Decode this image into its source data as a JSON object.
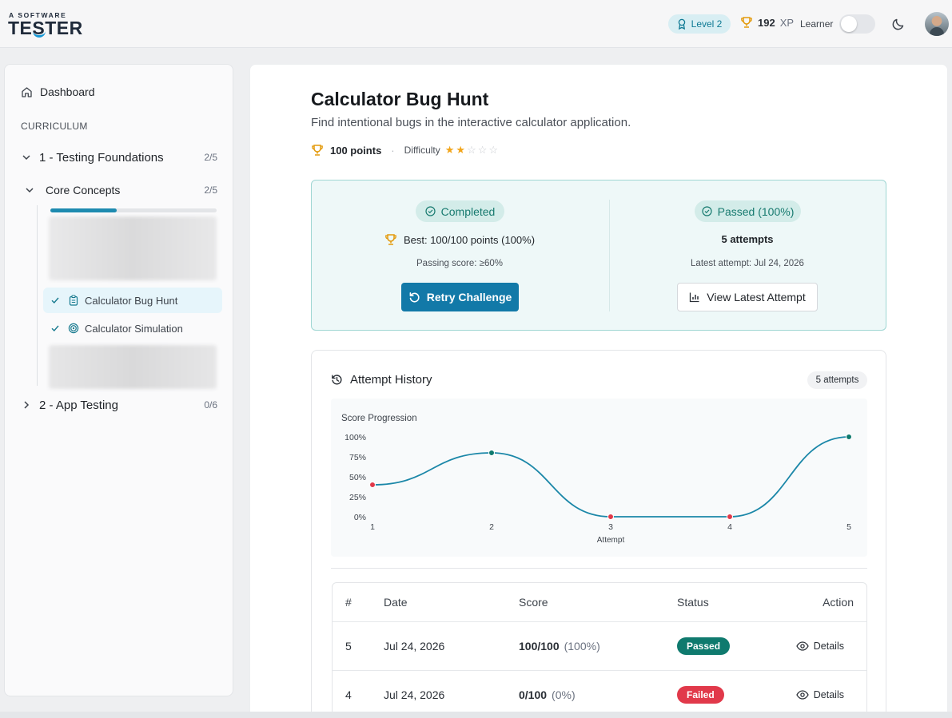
{
  "header": {
    "logo_small": "A SOFTWARE",
    "logo_big": "TESTER",
    "level": "Level 2",
    "xp_value": "192",
    "xp_unit": "XP",
    "role_label": "Learner"
  },
  "sidebar": {
    "dashboard": "Dashboard",
    "section": "CURRICULUM",
    "modules": [
      {
        "title": "1 - Testing Foundations",
        "count": "2/5"
      },
      {
        "title": "2 - App Testing",
        "count": "0/6"
      }
    ],
    "submodule": {
      "title": "Core Concepts",
      "count": "2/5",
      "progress": 0.4
    },
    "lessons": [
      {
        "title": "Calculator Bug Hunt"
      },
      {
        "title": "Calculator Simulation"
      }
    ]
  },
  "challenge": {
    "title": "Calculator Bug Hunt",
    "description": "Find intentional bugs in the interactive calculator application.",
    "points": "100 points",
    "difficulty_label": "Difficulty",
    "difficulty_rating": 2,
    "difficulty_max": 5
  },
  "status": {
    "completed": "Completed",
    "best": "Best: 100/100 points (100%)",
    "passing": "Passing score: ≥60%",
    "retry": "Retry Challenge",
    "passed": "Passed (100%)",
    "attempts": "5 attempts",
    "latest": "Latest attempt: Jul 24, 2026",
    "view_latest": "View Latest Attempt"
  },
  "history": {
    "title": "Attempt History",
    "badge": "5 attempts",
    "table_headers": [
      "#",
      "Date",
      "Score",
      "Status",
      "Action"
    ],
    "rows": [
      {
        "num": "5",
        "date": "Jul 24, 2026",
        "score": "100/100",
        "pct": "(100%)",
        "status": "Passed",
        "action": "Details"
      },
      {
        "num": "4",
        "date": "Jul 24, 2026",
        "score": "0/100",
        "pct": "(0%)",
        "status": "Failed",
        "action": "Details"
      }
    ]
  },
  "chart_data": {
    "type": "line",
    "title": "Score Progression",
    "xlabel": "Attempt",
    "ylabel": "",
    "x": [
      1,
      2,
      3,
      4,
      5
    ],
    "y_ticks": [
      "0%",
      "25%",
      "50%",
      "75%",
      "100%"
    ],
    "ylim": [
      0,
      100
    ],
    "series": [
      {
        "values": [
          40,
          80,
          0,
          0,
          100
        ]
      }
    ],
    "pass_threshold": 60,
    "colors": {
      "line": "#1b87a8",
      "pass": "#0f7a6e",
      "fail": "#e1394a"
    }
  },
  "colors": {
    "accent": "#1279a8",
    "passed": "#0f7a6e",
    "failed": "#e1394a",
    "star": "#f2a51a"
  }
}
